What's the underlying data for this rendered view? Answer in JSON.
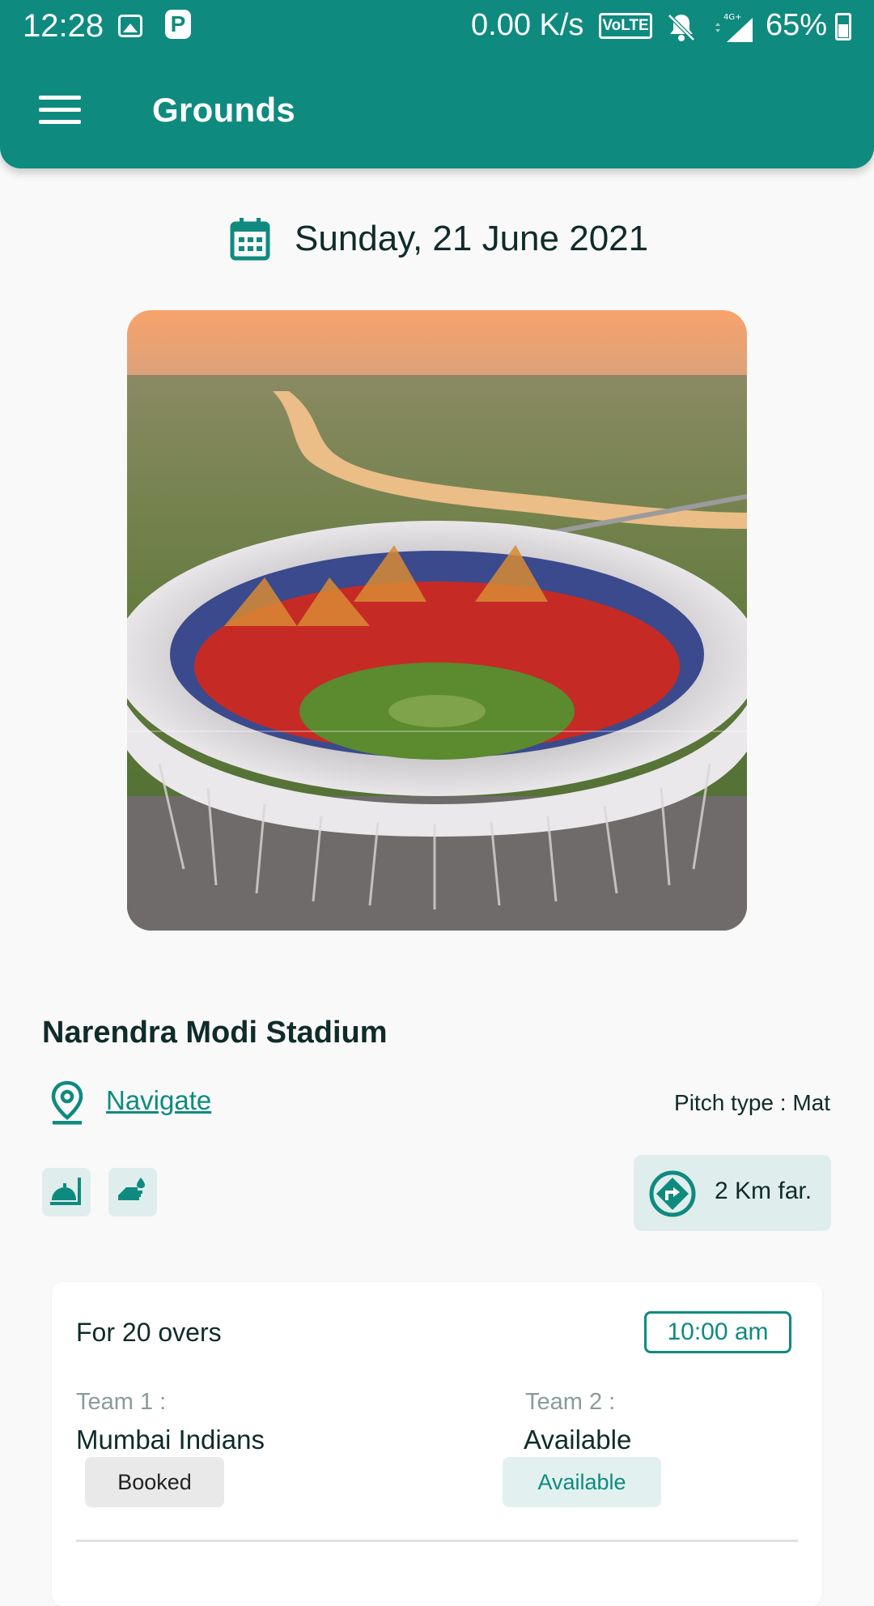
{
  "status_bar": {
    "time": "12:28",
    "network_speed": "0.00 K/s",
    "volte": "VoLTE",
    "signal_label": "4G+",
    "battery": "65%"
  },
  "app_bar": {
    "title": "Grounds"
  },
  "date": {
    "text": "Sunday, 21 June 2021"
  },
  "ground": {
    "name": "Narendra Modi Stadium",
    "navigate_label": "Navigate",
    "pitch_type": "Pitch type : Mat",
    "distance": "2 Km far."
  },
  "slot": {
    "overs": "For 20 overs",
    "time": "10:00 am",
    "team1_label": "Team 1 :",
    "team1_name": "Mumbai Indians",
    "team1_status": "Booked",
    "team2_label": "Team 2 :",
    "team2_name": "Available",
    "team2_status": "Available"
  },
  "colors": {
    "primary": "#0f8a7f",
    "chip_bg": "#dfeeec"
  }
}
